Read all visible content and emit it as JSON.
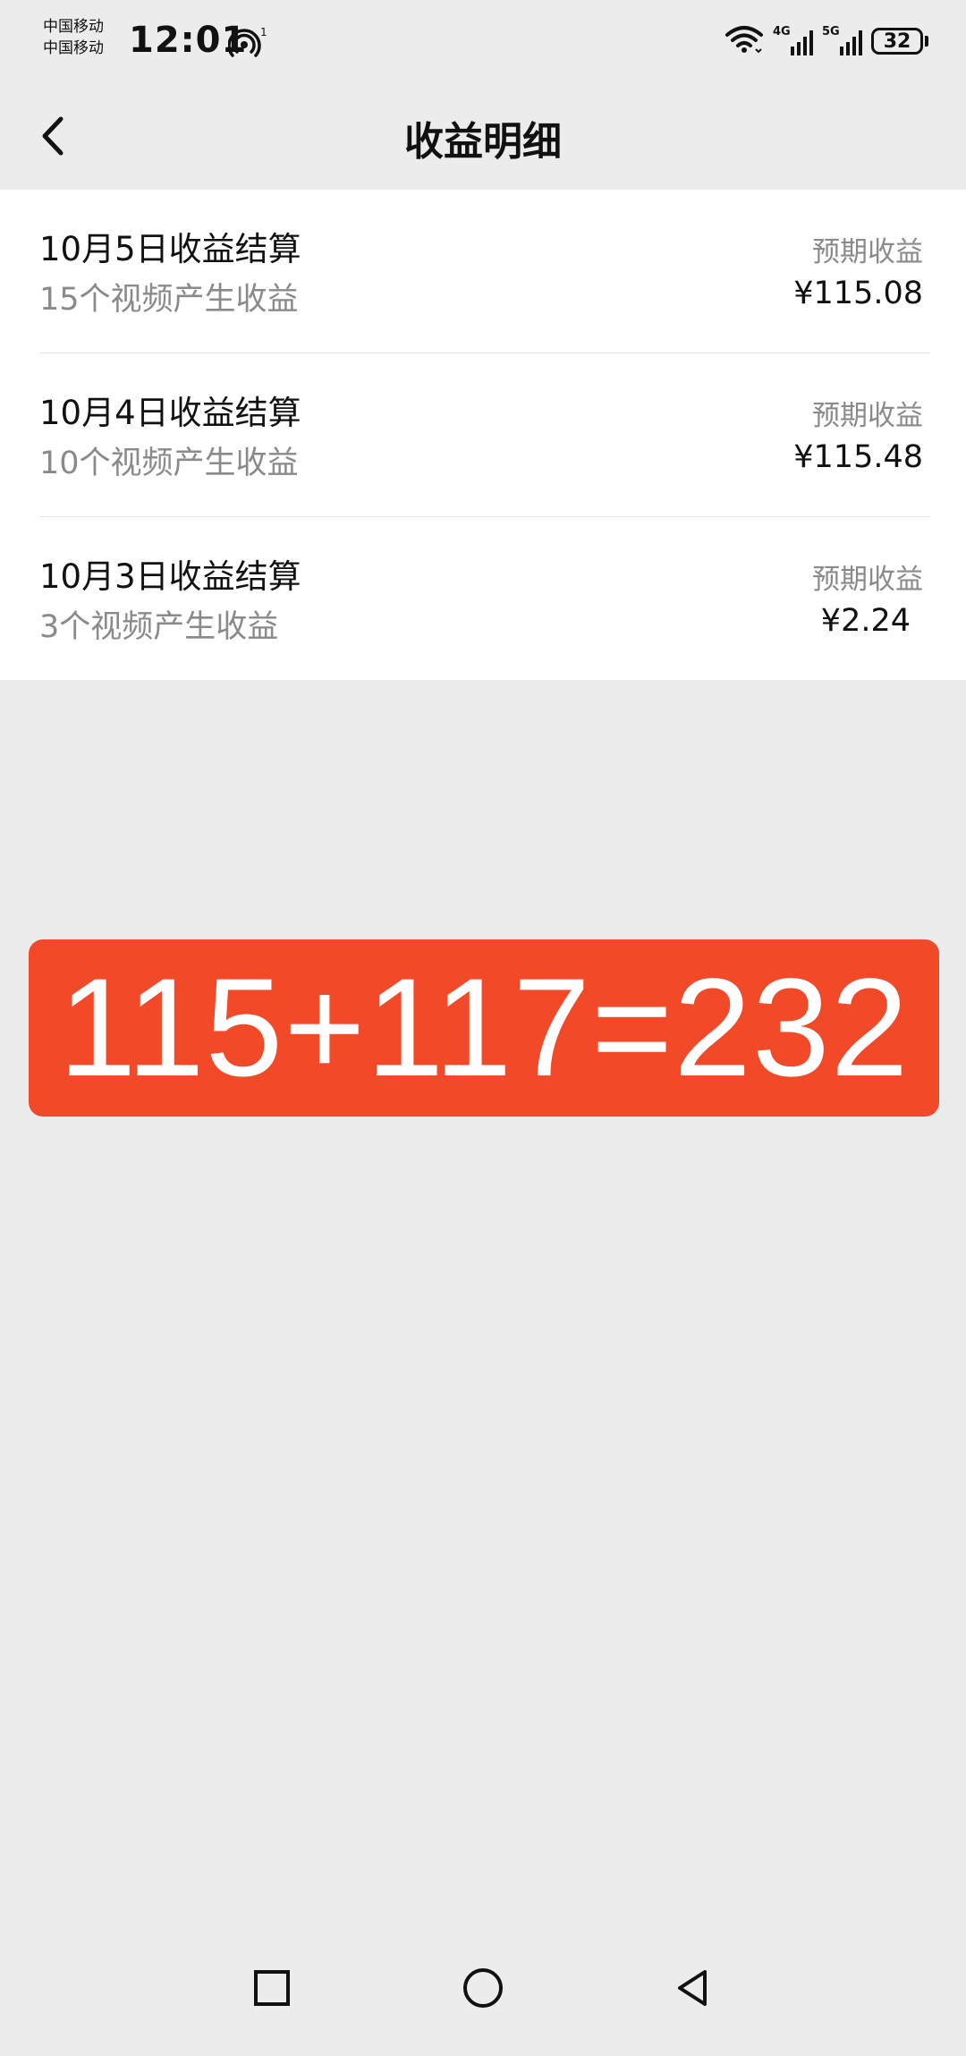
{
  "status_bar": {
    "carrier_1": "中国移动",
    "carrier_2": "中国移动",
    "time": "12:01",
    "hotspot_badge": "1",
    "sim1_network": "4G",
    "sim2_network": "5G",
    "battery_level": "32"
  },
  "header": {
    "title": "收益明细"
  },
  "earnings": [
    {
      "title": "10月5日收益结算",
      "subtitle": "15个视频产生收益",
      "label": "预期收益",
      "amount": "¥115.08"
    },
    {
      "title": "10月4日收益结算",
      "subtitle": "10个视频产生收益",
      "label": "预期收益",
      "amount": "¥115.48"
    },
    {
      "title": "10月3日收益结算",
      "subtitle": "3个视频产生收益",
      "label": "预期收益",
      "amount": "¥2.24"
    }
  ],
  "banner": {
    "text": "115+117=232",
    "color": "#f24a28"
  },
  "icons": {
    "back": "chevron-left-icon",
    "recent": "square-icon",
    "home": "circle-icon",
    "back_nav": "triangle-left-icon"
  }
}
